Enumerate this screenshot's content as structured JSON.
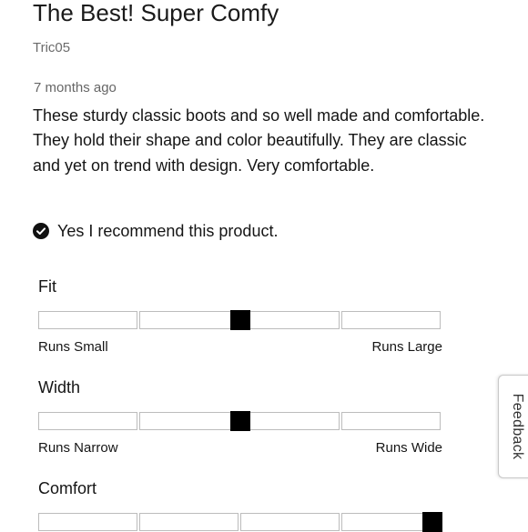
{
  "review": {
    "title": "The Best! Super Comfy",
    "reviewer": "Tric05",
    "date": "7 months ago",
    "body": "These sturdy classic boots and so well made and comfortable. They hold their shape and color beautifully. They are classic and yet on trend with design. Very comfortable.",
    "recommendation": "Yes I recommend this product."
  },
  "ratings": [
    {
      "label": "Fit",
      "min_label": "Runs Small",
      "max_label": "Runs Large",
      "segments": 4,
      "value": 0.5
    },
    {
      "label": "Width",
      "min_label": "Runs Narrow",
      "max_label": "Runs Wide",
      "segments": 4,
      "value": 0.5
    },
    {
      "label": "Comfort",
      "min_label": "",
      "max_label": "",
      "segments": 4,
      "value": 1.0
    }
  ],
  "feedback_tab": {
    "label": "Feedback"
  },
  "icons": {
    "recommend": "check-circle-icon"
  },
  "colors": {
    "marker": "#000000",
    "segment_border": "#bcbcbc",
    "text": "#151515",
    "muted": "#6b6b6b"
  }
}
